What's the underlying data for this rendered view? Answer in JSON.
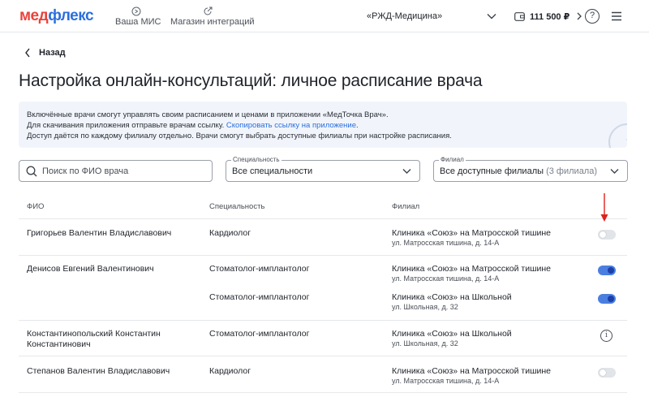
{
  "topbar": {
    "logo_part1": "мед",
    "logo_part2": "флекс",
    "nav": [
      {
        "label": "Ваша МИС",
        "icon": "mis-icon"
      },
      {
        "label": "Магазин интеграций",
        "icon": "integrations-icon"
      }
    ],
    "organization": "«РЖД-Медицина»",
    "balance": "111 500 ₽",
    "help": "?"
  },
  "back_label": "Назад",
  "page_title": "Настройка онлайн-консультаций: личное расписание врача",
  "info": {
    "line1": "Включённые врачи смогут управлять своим расписанием и ценами в приложении «МедТочка Врач».",
    "line2_text": "Для скачивания приложения отправьте врачам ссылку. ",
    "line2_link": "Скопировать ссылку на приложение",
    "line2_end": ".",
    "line3": "Доступ даётся по каждому филиалу отдельно. Врачи смогут выбрать доступные филиалы при настройке расписания."
  },
  "filters": {
    "search_placeholder": "Поиск по ФИО врача",
    "specialty_label": "Специальность",
    "specialty_value": "Все специальности",
    "branch_label": "Филиал",
    "branch_value": "Все доступные филиалы",
    "branch_count": "(3 филиала)"
  },
  "table": {
    "headers": {
      "name": "ФИО",
      "specialty": "Специальность",
      "branch": "Филиал"
    },
    "rows": [
      {
        "name": "Григорьев Валентин Владиславович",
        "name2": "",
        "specialty": "Кардиолог",
        "branch": "Клиника «Союз» на Матросской тишине",
        "address": "ул. Матросская тишина, д. 14-А",
        "state": "off"
      },
      {
        "name": "Денисов Евгений Валентинович",
        "name2": "",
        "specialty": "Стоматолог-имплантолог",
        "branch": "Клиника «Союз» на Матросской тишине",
        "address": "ул. Матросская тишина, д. 14-А",
        "state": "on"
      },
      {
        "name": "",
        "name2": "",
        "specialty": "Стоматолог-имплантолог",
        "branch": "Клиника «Союз» на Школьной",
        "address": "ул. Школьная, д. 32",
        "state": "on"
      },
      {
        "name": "Константинопольский Константин",
        "name2": "Константинович",
        "specialty": "Стоматолог-имплантолог",
        "branch": "Клиника «Союз» на Школьной",
        "address": "ул. Школьная, д. 32",
        "state": "info"
      },
      {
        "name": "Степанов Валентин Владиславович",
        "name2": "",
        "specialty": "Кардиолог",
        "branch": "Клиника «Союз» на Матросской тишине",
        "address": "ул. Матросская тишина, д. 14-А",
        "state": "off"
      }
    ],
    "info_glyph": "i"
  },
  "colors": {
    "brand_red": "#e8433a",
    "brand_blue": "#2b6fdc",
    "toggle_on": "#4a7fe0",
    "annotation_arrow": "#e0201b"
  }
}
